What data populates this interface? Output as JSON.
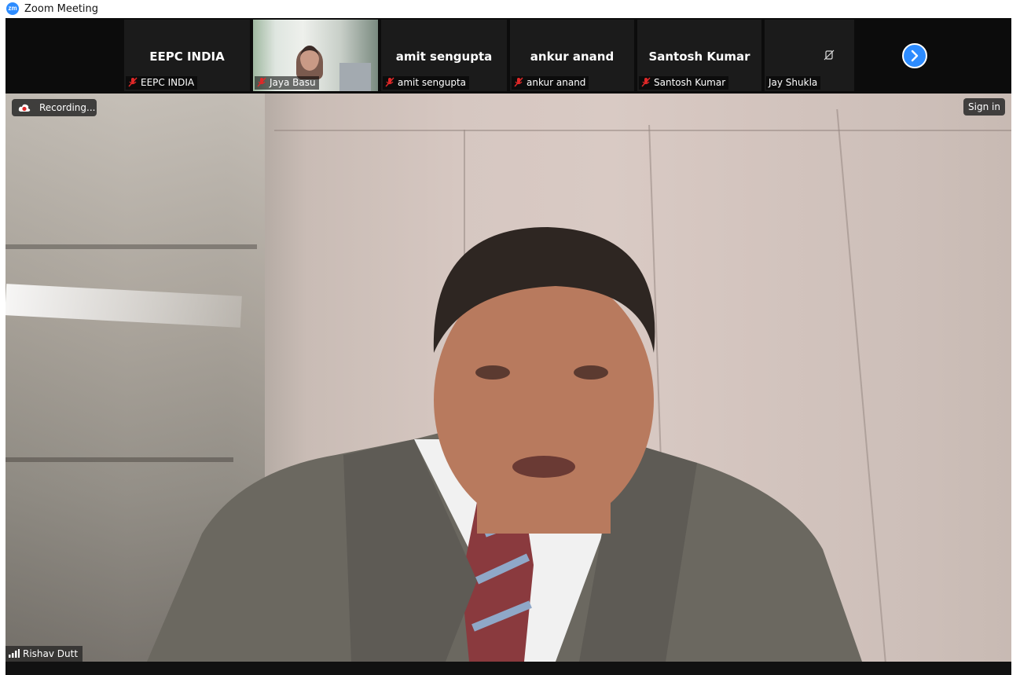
{
  "window": {
    "title": "Zoom Meeting",
    "app_icon_text": "zm"
  },
  "participants": [
    {
      "display_name": "EEPC INDIA",
      "label": "EEPC INDIA",
      "muted": true,
      "video": false
    },
    {
      "display_name": "",
      "label": "Jaya Basu",
      "muted": true,
      "video": true
    },
    {
      "display_name": "amit sengupta",
      "label": "amit sengupta",
      "muted": true,
      "video": false
    },
    {
      "display_name": "ankur anand",
      "label": "ankur anand",
      "muted": true,
      "video": false
    },
    {
      "display_name": "Santosh Kumar",
      "label": "Santosh Kumar",
      "muted": true,
      "video": false
    },
    {
      "display_name": "",
      "label": "Jay Shukla",
      "muted": false,
      "video": false
    }
  ],
  "main_video": {
    "recording_label": "Recording...",
    "sign_in_label": "Sign in",
    "speaker_name": "Rishav Dutt"
  },
  "colors": {
    "accent": "#2d8cff",
    "mute_red": "#e02828",
    "record_red": "#e02828"
  },
  "icons": {
    "next_page": "chevron-right-icon",
    "recording": "cloud-record-icon",
    "muted": "mic-off-icon",
    "signal": "signal-bars-icon",
    "no_video": "video-off-icon"
  }
}
